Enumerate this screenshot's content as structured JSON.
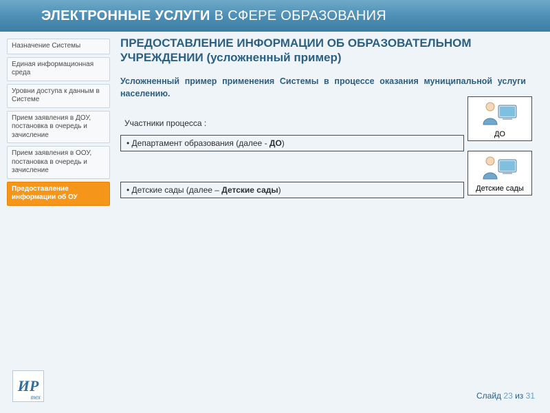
{
  "header": {
    "bold": "ЭЛЕКТРОННЫЕ УСЛУГИ",
    "light": "В СФЕРЕ ОБРАЗОВАНИЯ"
  },
  "sidebar": {
    "items": [
      {
        "label": "Назначение Системы",
        "active": false
      },
      {
        "label": "Единая информационная среда",
        "active": false
      },
      {
        "label": "Уровни доступа к данным в Системе",
        "active": false
      },
      {
        "label": "Прием заявления в ДОУ, постановка в очередь и зачисление",
        "active": false
      },
      {
        "label": "Прием заявления в ООУ, постановка в очередь и зачисление",
        "active": false
      },
      {
        "label": "Предоставление информации об ОУ",
        "active": true
      }
    ]
  },
  "content": {
    "title": "ПРЕДОСТАВЛЕНИЕ ИНФОРМАЦИИ ОБ ОБРАЗОВАТЕЛЬНОМ УЧРЕЖДЕНИИ (усложненный пример)",
    "intro": "Усложненный пример применения Системы в процессе оказания муниципальной услуги населению.",
    "participants_header": "Участники процесса :",
    "row1_prefix": "• Департамент образования (далее - ",
    "row1_bold": "ДО",
    "row1_suffix": ")",
    "row2_prefix": "• Детские сады (далее – ",
    "row2_bold": "Детские сады",
    "row2_suffix": ")",
    "actor1_label": "ДО",
    "actor2_label": "Детские сады"
  },
  "logo": {
    "text": "ИР",
    "sub": "тех"
  },
  "footer": {
    "word": "Слайд ",
    "current": "23",
    "sep": " из ",
    "total": "31"
  }
}
